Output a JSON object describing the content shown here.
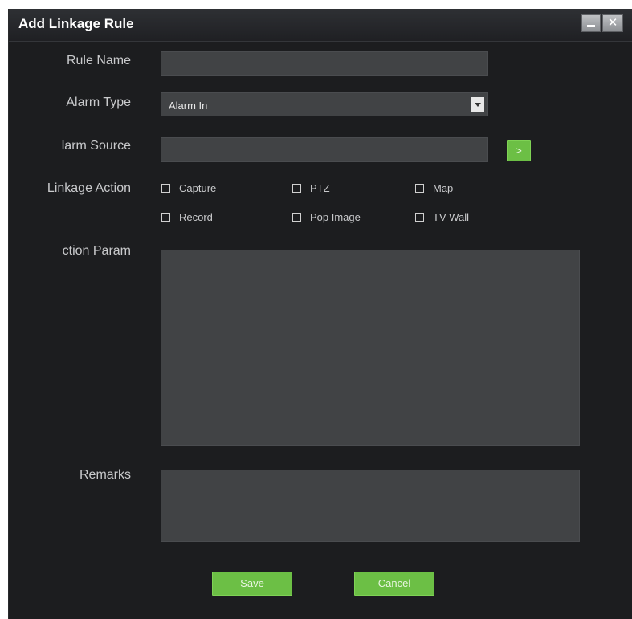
{
  "dialog": {
    "title": "Add Linkage Rule",
    "minimize_symbol": "",
    "close_symbol": "✕"
  },
  "form": {
    "rule_name": {
      "label": "Rule Name",
      "value": ""
    },
    "alarm_type": {
      "label": "Alarm Type",
      "value": "Alarm In"
    },
    "alarm_source": {
      "label": "larm Source",
      "value": "",
      "browse_label": ">"
    },
    "linkage_action": {
      "label": "Linkage Action",
      "options": [
        {
          "label": "Capture",
          "checked": false
        },
        {
          "label": "PTZ",
          "checked": false
        },
        {
          "label": "Map",
          "checked": false
        },
        {
          "label": "Record",
          "checked": false
        },
        {
          "label": "Pop Image",
          "checked": false
        },
        {
          "label": "TV Wall",
          "checked": false
        }
      ]
    },
    "action_param": {
      "label": "ction Param",
      "value": ""
    },
    "remarks": {
      "label": "Remarks",
      "value": ""
    }
  },
  "buttons": {
    "save": "Save",
    "cancel": "Cancel"
  },
  "colors": {
    "background": "#1c1d1f",
    "field": "#414345",
    "accent_green": "#6cbf45",
    "text": "#c9cacc"
  },
  "icons": {
    "minimize": "minimize-icon",
    "close": "close-icon",
    "dropdown": "chevron-down-icon"
  }
}
